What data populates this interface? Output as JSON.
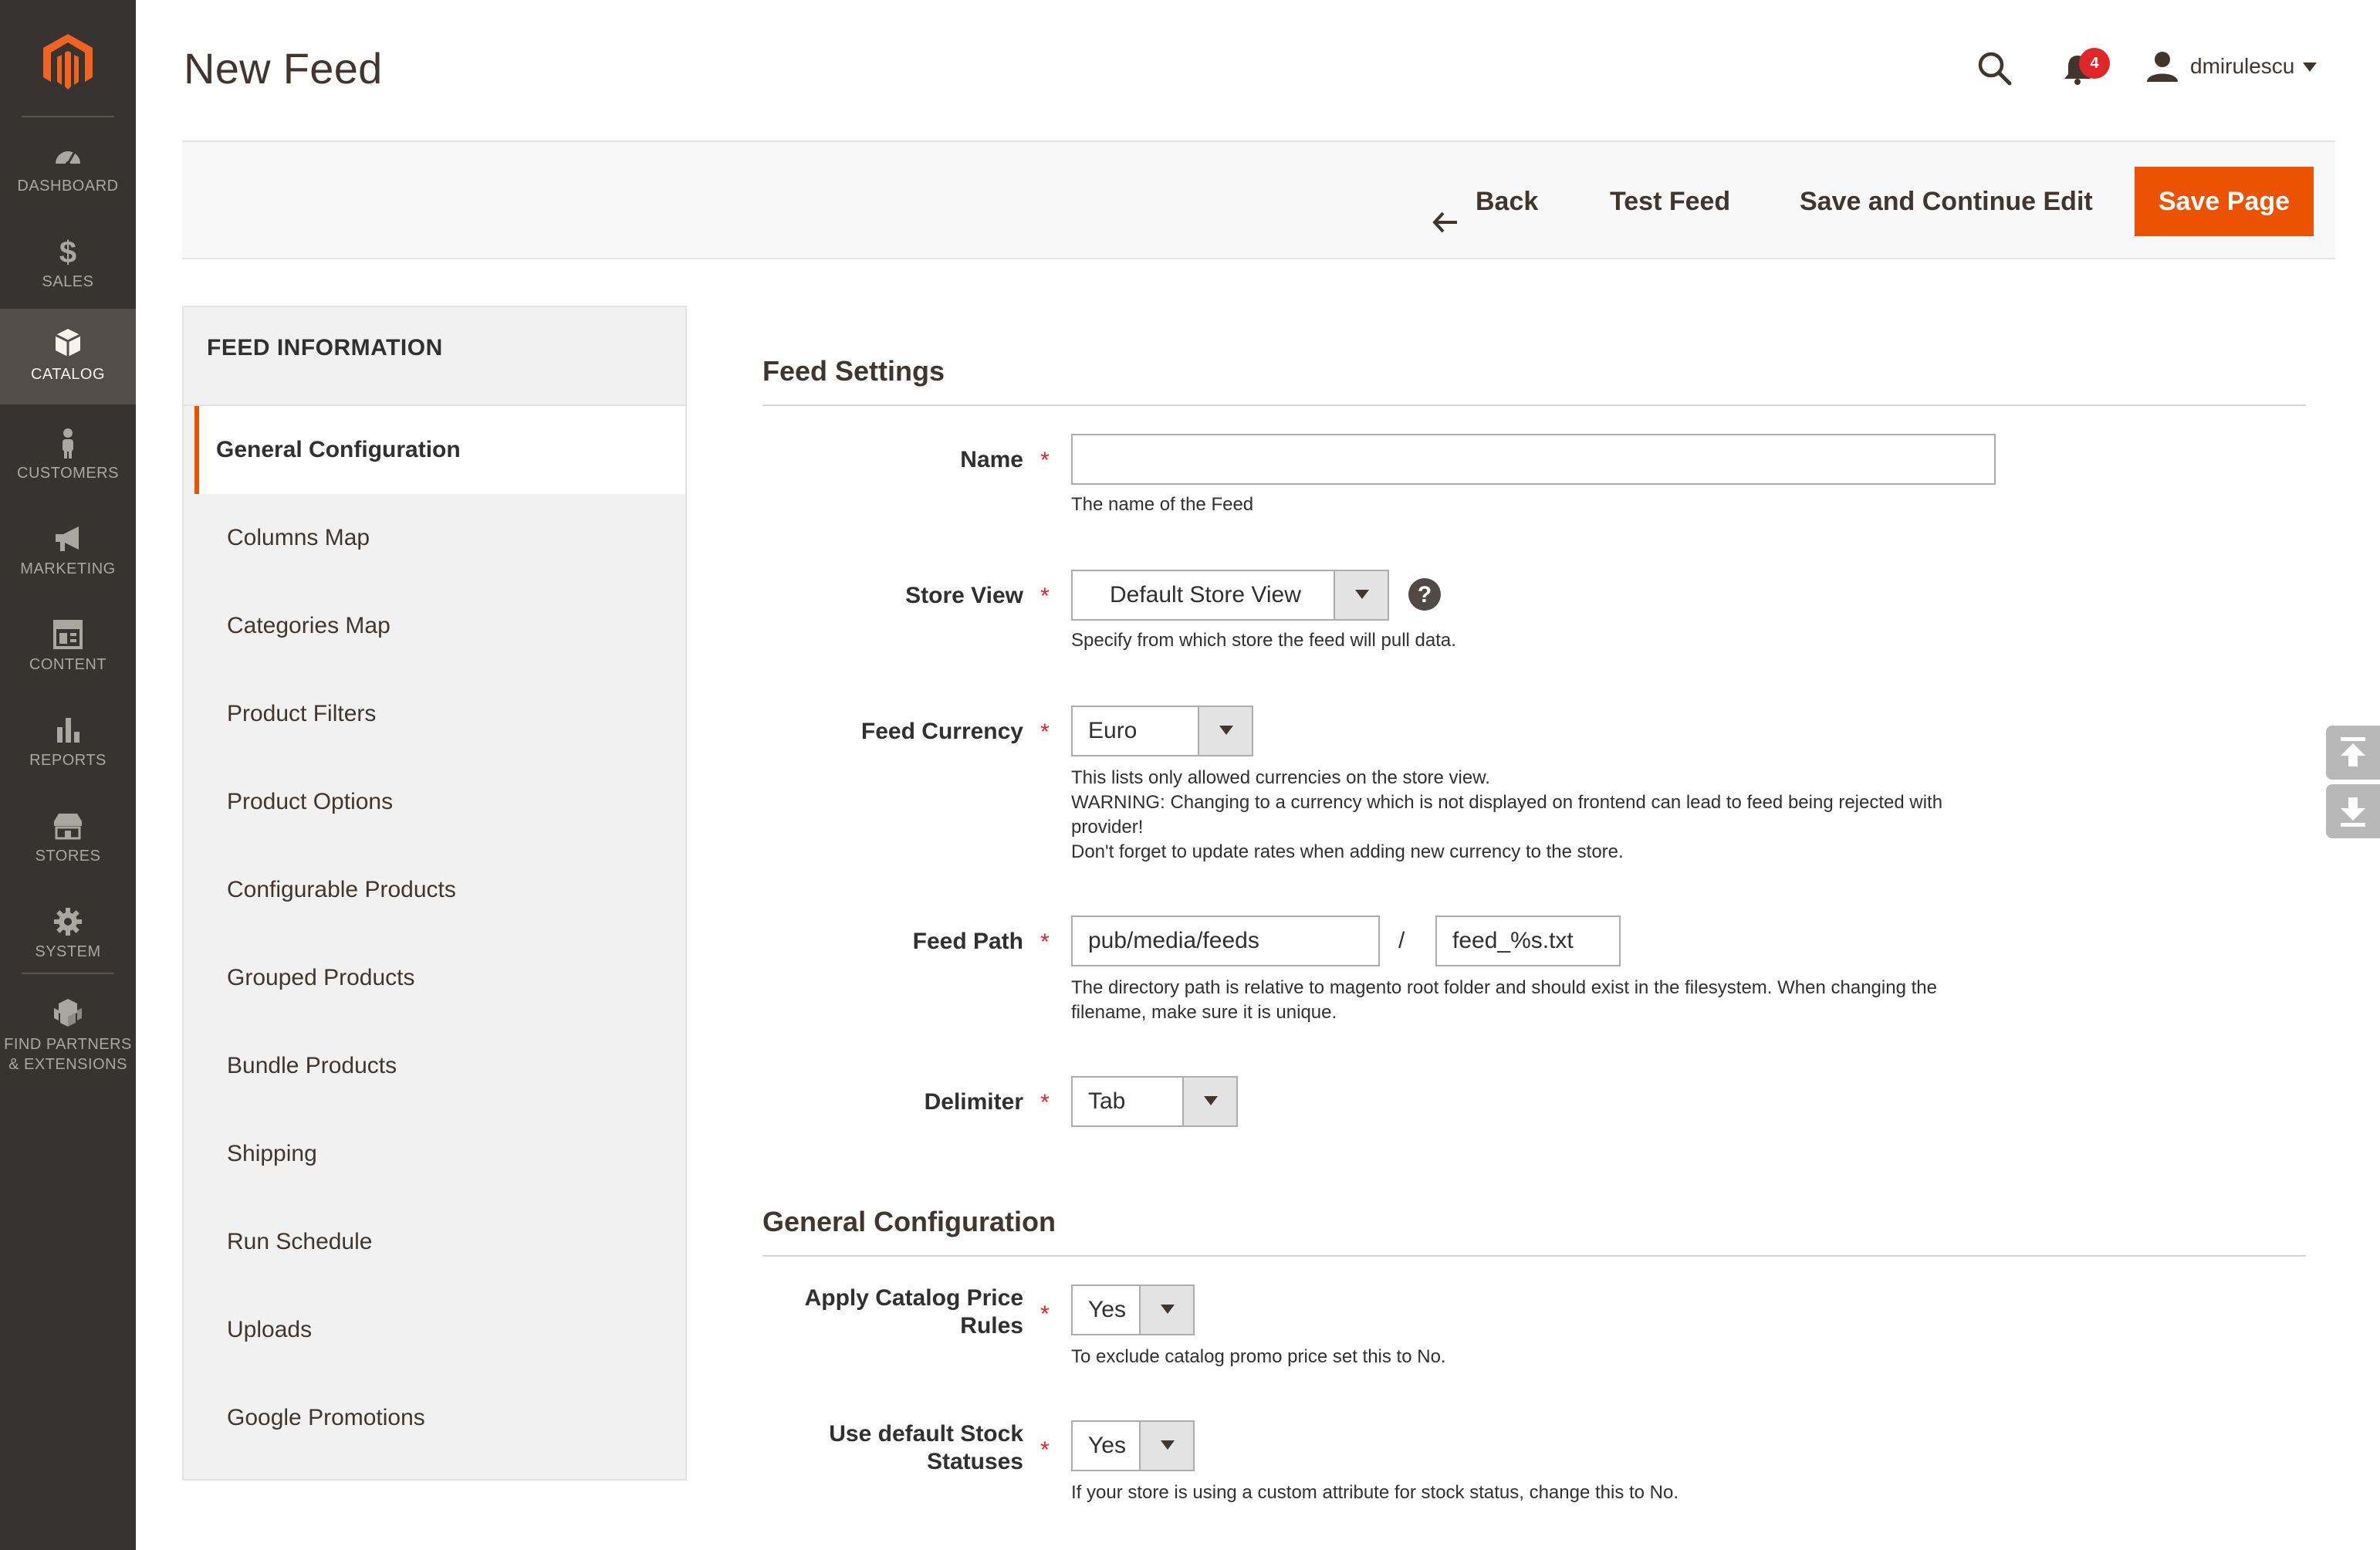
{
  "nav": {
    "items": [
      {
        "label": "DASHBOARD",
        "icon": "dashboard-icon"
      },
      {
        "label": "SALES",
        "icon": "dollar-icon"
      },
      {
        "label": "CATALOG",
        "icon": "box-icon",
        "active": true
      },
      {
        "label": "CUSTOMERS",
        "icon": "person-icon"
      },
      {
        "label": "MARKETING",
        "icon": "megaphone-icon"
      },
      {
        "label": "CONTENT",
        "icon": "layout-icon"
      },
      {
        "label": "REPORTS",
        "icon": "bar-chart-icon"
      },
      {
        "label": "STORES",
        "icon": "storefront-icon"
      },
      {
        "label": "SYSTEM",
        "icon": "gear-icon"
      }
    ],
    "partners_line1": "FIND PARTNERS",
    "partners_line2": "& EXTENSIONS"
  },
  "header": {
    "title": "New Feed",
    "notification_count": "4",
    "username": "dmirulescu"
  },
  "actions": {
    "back": "Back",
    "test": "Test Feed",
    "save_continue": "Save and Continue Edit",
    "save_page": "Save Page"
  },
  "sidebar": {
    "title": "FEED INFORMATION",
    "tabs": [
      "General Configuration",
      "Columns Map",
      "Categories Map",
      "Product Filters",
      "Product Options",
      "Configurable Products",
      "Grouped Products",
      "Bundle Products",
      "Shipping",
      "Run Schedule",
      "Uploads",
      "Google Promotions"
    ]
  },
  "feed_settings": {
    "title": "Feed Settings",
    "name": {
      "label": "Name",
      "value": "",
      "note": "The name of the Feed"
    },
    "store_view": {
      "label": "Store View",
      "value": "Default Store View",
      "note": "Specify from which store the feed will pull data."
    },
    "currency": {
      "label": "Feed Currency",
      "value": "Euro",
      "note1": "This lists only allowed currencies on the store view.",
      "note2": "WARNING: Changing to a currency which is not displayed on frontend can lead to feed being rejected with provider!",
      "note3": "Don't forget to update rates when adding new currency to the store."
    },
    "path": {
      "label": "Feed Path",
      "dir": "pub/media/feeds",
      "separator": "/",
      "file": "feed_%s.txt",
      "note": "The directory path is relative to magento root folder and should exist in the filesystem. When changing the filename, make sure it is unique."
    },
    "delimiter": {
      "label": "Delimiter",
      "value": "Tab"
    }
  },
  "general_config": {
    "title": "General Configuration",
    "catalog_rules": {
      "label_line1": "Apply Catalog Price",
      "label_line2": "Rules",
      "value": "Yes",
      "note": "To exclude catalog promo price set this to No."
    },
    "stock": {
      "label_line1": "Use default Stock",
      "label_line2": "Statuses",
      "value": "Yes",
      "note": "If your store is using a custom attribute for stock status, change this to No."
    }
  },
  "colors": {
    "accent": "#eb5202",
    "nav_bg": "#373330",
    "required": "#e22626"
  }
}
